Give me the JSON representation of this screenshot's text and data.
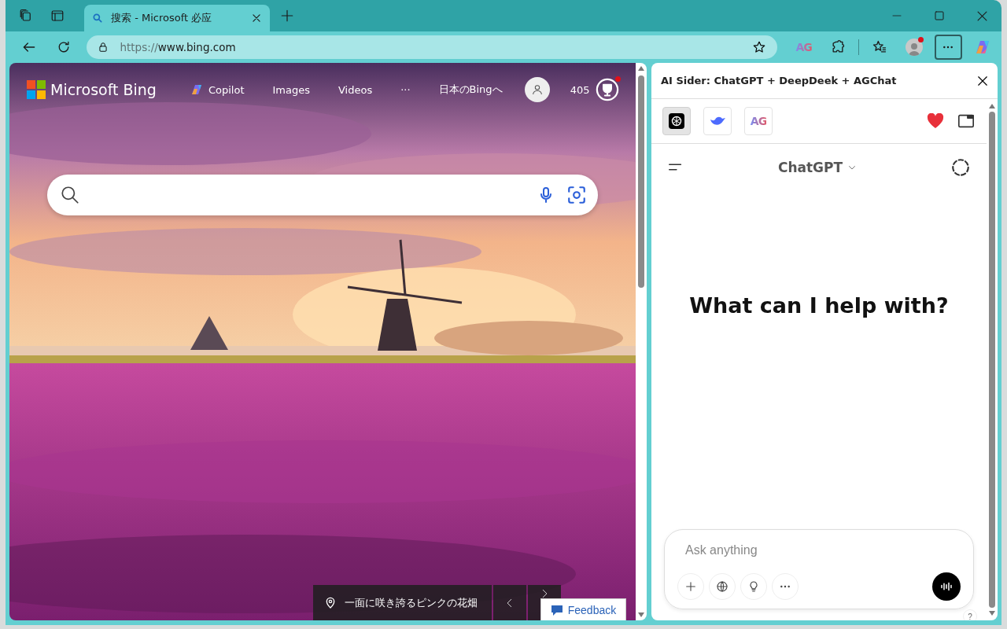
{
  "browser": {
    "tabs": [
      {
        "title": "搜索 - Microsoft 必应",
        "selected": true
      }
    ],
    "url_scheme": "https://",
    "url_host": "www.bing.com",
    "extension_label": "AG",
    "profile_notification": true,
    "more_active": true
  },
  "bing": {
    "brand": "Microsoft Bing",
    "nav": [
      {
        "kind": "copilot",
        "label": "Copilot"
      },
      {
        "kind": "link",
        "label": "Images"
      },
      {
        "kind": "link",
        "label": "Videos"
      },
      {
        "kind": "link",
        "label": "···"
      },
      {
        "kind": "link",
        "label": "日本のBingへ"
      }
    ],
    "points": "405",
    "rewards_notification": true,
    "caption": "一面に咲き誇るピンクの花畑",
    "feedback": "Feedback"
  },
  "sider": {
    "title": "AI Sider: ChatGPT + DeepDeek + AGChat",
    "tabs": [
      {
        "kind": "chatgpt",
        "selected": true
      },
      {
        "kind": "deepseek",
        "selected": false
      },
      {
        "kind": "agchat",
        "label": "AG",
        "selected": false
      }
    ],
    "model": "ChatGPT",
    "heading": "What can I help with?",
    "placeholder": "Ask anything",
    "help": "?"
  }
}
